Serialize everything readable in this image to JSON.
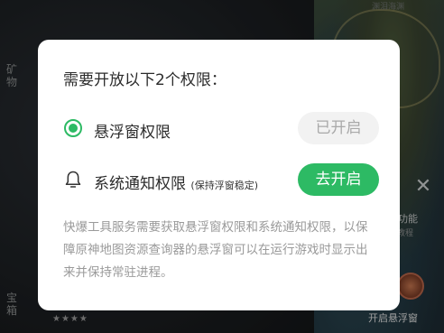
{
  "background": {
    "left_sidebar": {
      "minerals_label": "矿物",
      "treasure_label": "宝箱"
    },
    "map": {
      "top_label": "渊泪海渊"
    },
    "right_panel": {
      "close_icon": "close-icon",
      "function_label": "功能",
      "tutorial_label": "教程",
      "float_window_label": "开启悬浮窗"
    },
    "rating": "★★★★"
  },
  "dialog": {
    "title": "需要开放以下2个权限：",
    "permissions": [
      {
        "icon": "radio-checked-icon",
        "label": "悬浮窗权限",
        "note": "",
        "button_label": "已开启",
        "enabled": true
      },
      {
        "icon": "bell-icon",
        "label": "系统通知权限",
        "note": "(保持浮窗稳定)",
        "button_label": "去开启",
        "enabled": false
      }
    ],
    "description": "快爆工具服务需要获取悬浮窗权限和系统通知权限，以保障原神地图资源查询器的悬浮窗可以在运行游戏时显示出来并保持常驻进程。"
  },
  "colors": {
    "accent": "#2dba64",
    "disabled_button_bg": "#f2f2f2",
    "disabled_button_text": "#a9a9a9",
    "description_text": "#9a9a9a"
  }
}
